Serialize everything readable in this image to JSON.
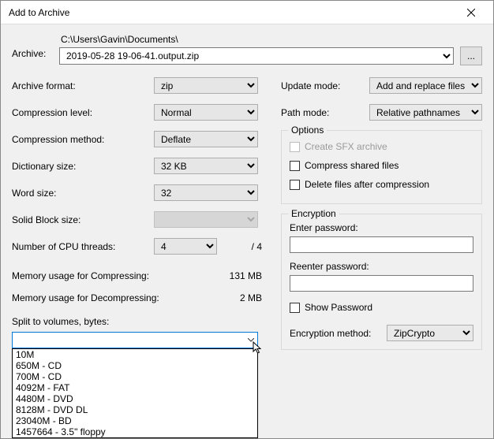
{
  "title": "Add to Archive",
  "archive": {
    "label": "Archive:",
    "path": "C:\\Users\\Gavin\\Documents\\",
    "filename": "2019-05-28 19-06-41.output.zip",
    "browse": "..."
  },
  "left": {
    "archive_format": {
      "label": "Archive format:",
      "value": "zip"
    },
    "compression_level": {
      "label": "Compression level:",
      "value": "Normal"
    },
    "compression_method": {
      "label": "Compression method:",
      "value": "Deflate"
    },
    "dictionary_size": {
      "label": "Dictionary size:",
      "value": "32 KB"
    },
    "word_size": {
      "label": "Word size:",
      "value": "32"
    },
    "solid_block_size": {
      "label": "Solid Block size:",
      "value": ""
    },
    "cpu_threads": {
      "label": "Number of CPU threads:",
      "value": "4",
      "total": "/  4"
    },
    "mem_compress": {
      "label": "Memory usage for Compressing:",
      "value": "131 MB"
    },
    "mem_decompress": {
      "label": "Memory usage for Decompressing:",
      "value": "2 MB"
    },
    "split": {
      "label": "Split to volumes, bytes:",
      "value": "",
      "options": [
        "10M",
        "650M - CD",
        "700M - CD",
        "4092M - FAT",
        "4480M - DVD",
        "8128M - DVD DL",
        "23040M - BD",
        "1457664 - 3.5\" floppy"
      ]
    }
  },
  "right": {
    "update_mode": {
      "label": "Update mode:",
      "value": "Add and replace files"
    },
    "path_mode": {
      "label": "Path mode:",
      "value": "Relative pathnames"
    },
    "options": {
      "legend": "Options",
      "sfx": "Create SFX archive",
      "compress_shared": "Compress shared files",
      "delete_after": "Delete files after compression"
    },
    "encryption": {
      "legend": "Encryption",
      "enter": "Enter password:",
      "reenter": "Reenter password:",
      "show": "Show Password",
      "method_label": "Encryption method:",
      "method_value": "ZipCrypto"
    }
  }
}
